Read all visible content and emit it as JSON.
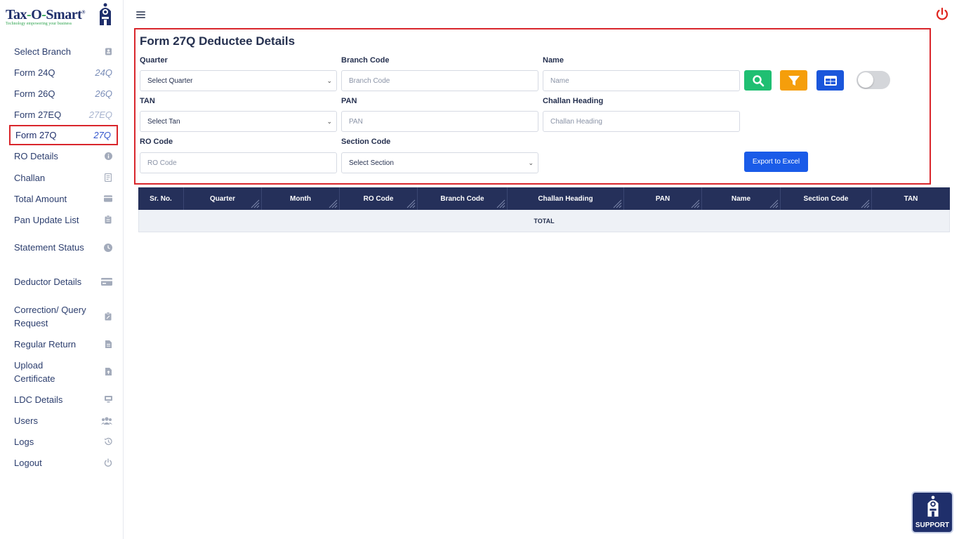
{
  "logo": {
    "name_part1": "Tax",
    "name_dash1": "-",
    "name_part2": "O",
    "name_dash2": "-",
    "name_part3": "Smart",
    "registered": "®",
    "tagline": "Technology empowering your business"
  },
  "sidebar": {
    "items": [
      {
        "label": "Select Branch",
        "icon": "contact-icon"
      },
      {
        "label": "Form 24Q",
        "code": "24Q"
      },
      {
        "label": "Form 26Q",
        "code": "26Q"
      },
      {
        "label": "Form 27EQ",
        "code": "27EQ"
      },
      {
        "label": "Form 27Q",
        "code": "27Q",
        "active": true
      },
      {
        "label": "RO Details",
        "icon": "info-icon"
      },
      {
        "label": "Challan",
        "icon": "receipt-icon"
      },
      {
        "label": "Total Amount",
        "icon": "wallet-icon"
      },
      {
        "label": "Pan Update List",
        "icon": "clipboard-icon"
      },
      {
        "label": "Statement Status",
        "icon": "clock-icon"
      },
      {
        "label": "Deductor Details",
        "icon": "card-icon"
      },
      {
        "label": "Correction/ Query Request",
        "icon": "clipboard-edit-icon"
      },
      {
        "label": "Regular Return",
        "icon": "document-icon"
      },
      {
        "label": "Upload Certificate",
        "icon": "file-upload-icon"
      },
      {
        "label": "LDC Details",
        "icon": "monitor-icon"
      },
      {
        "label": "Users",
        "icon": "users-icon"
      },
      {
        "label": "Logs",
        "icon": "history-icon"
      },
      {
        "label": "Logout",
        "icon": "power-icon"
      }
    ]
  },
  "header": {
    "menu_icon": "hamburger-icon",
    "power_icon": "power-icon",
    "power_color": "#e0261f"
  },
  "form": {
    "title": "Form 27Q Deductee Details",
    "quarter": {
      "label": "Quarter",
      "value": "Select Quarter"
    },
    "branch_code": {
      "label": "Branch Code",
      "placeholder": "Branch Code"
    },
    "name": {
      "label": "Name",
      "placeholder": "Name"
    },
    "tan": {
      "label": "TAN",
      "value": "Select Tan"
    },
    "pan": {
      "label": "PAN",
      "placeholder": "PAN"
    },
    "challan_heading": {
      "label": "Challan Heading",
      "placeholder": "Challan Heading"
    },
    "ro_code": {
      "label": "RO Code",
      "placeholder": "RO Code"
    },
    "section_code": {
      "label": "Section Code",
      "value": "Select Section"
    },
    "buttons": {
      "search": {
        "icon": "search-icon",
        "color": "#1fbf72"
      },
      "filter": {
        "icon": "filter-icon",
        "color": "#f59e0b"
      },
      "columns": {
        "icon": "table-icon",
        "color": "#1a56db"
      },
      "export_label": "Export to Excel"
    },
    "toggle_on": false
  },
  "table": {
    "columns": [
      "Sr. No.",
      "Quarter",
      "Month",
      "RO Code",
      "Branch Code",
      "Challan Heading",
      "PAN",
      "Name",
      "Section Code",
      "TAN"
    ],
    "total_label": "TOTAL"
  },
  "support": {
    "label": "SUPPORT"
  },
  "colors": {
    "accent": "#25305a",
    "highlight": "#d9262c",
    "primary": "#1a5be8"
  }
}
